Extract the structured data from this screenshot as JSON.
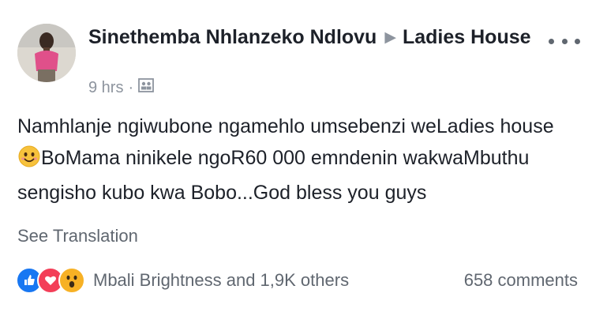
{
  "post": {
    "author": "Sinethemba Nhlanzeko Ndlovu",
    "group": "Ladies House",
    "time": "9 hrs",
    "separator": "·",
    "privacy_icon": "group-audience-icon",
    "more_icon": "more-options-icon",
    "text_part1": "Namhlanje ngiwubone ngamehlo umsebenzi weLadies house",
    "emoji": "smiling-face-emoji",
    "text_part2": "BoMama ninikele ngoR60 000 emndenin wakwaMbuthu sengisho kubo kwa Bobo...God bless you guys",
    "see_translation": "See Translation"
  },
  "footer": {
    "reaction_icons": [
      "like-icon",
      "love-icon",
      "wow-icon"
    ],
    "reactions_text": "Mbali Brightness and 1,9K others",
    "comments_text": "658 comments"
  },
  "colors": {
    "text": "#1d2129",
    "secondary": "#606770",
    "meta": "#8d949e",
    "like": "#1877f2",
    "love": "#f33e58",
    "wow": "#f7b125"
  }
}
